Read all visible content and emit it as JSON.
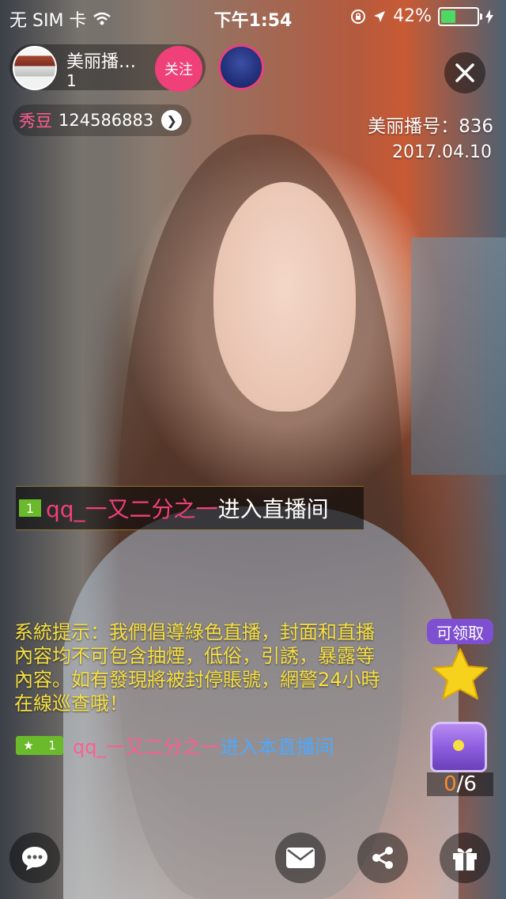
{
  "status_bar": {
    "carrier": "无 SIM 卡",
    "time": "下午1:54",
    "battery": "42%",
    "battery_level": 0.42
  },
  "host": {
    "name": "美丽播…",
    "count": "1",
    "follow_label": "关注"
  },
  "beans": {
    "label": "秀豆",
    "value": "124586883"
  },
  "room": {
    "number": "美丽播号：836",
    "date": "2017.04.10"
  },
  "enter_banner": {
    "level": "1",
    "user": "qq_一又二分之一",
    "text": "进入直播间"
  },
  "system_notice": "系統提示：我們倡導綠色直播，封面和直播內容均不可包含抽煙，低俗，引誘，暴露等內容。如有發現將被封停賬號，網警24小時在線巡查哦！",
  "chat": {
    "badge_level": "1",
    "user": "qq_一又二分之一",
    "text": "进入本直播间"
  },
  "reward": {
    "claim_label": "可领取",
    "chest_current": "0",
    "chest_total": "/6"
  },
  "colors": {
    "accent_pink": "#f0407a",
    "notice_yellow": "#f7e042",
    "chat_blue": "#4da9ff",
    "level_green": "#6aba2b",
    "claim_purple": "#7e4fd1"
  },
  "icons": [
    "wifi-icon",
    "lock-rotation-icon",
    "location-icon",
    "battery-icon",
    "close-icon",
    "chevron-right-icon",
    "star-icon",
    "treasure-chest-icon",
    "chat-bubble-icon",
    "mail-icon",
    "share-icon",
    "gift-icon"
  ]
}
